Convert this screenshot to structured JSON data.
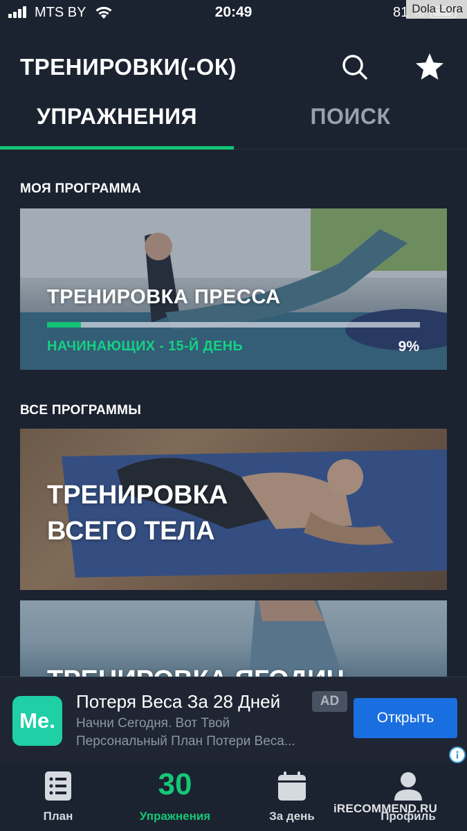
{
  "status_bar": {
    "carrier": "MTS BY",
    "time": "20:49",
    "battery": "81 %"
  },
  "watermark_top": "Dola Lora",
  "header": {
    "title": "ТРЕНИРОВКИ(-ОК)",
    "search_icon": "search-icon",
    "favorite_icon": "star-icon"
  },
  "tabs": [
    {
      "label": "УПРАЖНЕНИЯ",
      "active": true
    },
    {
      "label": "ПОИСК",
      "active": false
    }
  ],
  "my_program": {
    "section_title": "МОЯ ПРОГРАММА",
    "card": {
      "title": "ТРЕНИРОВКА ПРЕССА",
      "subtitle": "НАЧИНАЮЩИХ - 15-Й ДЕНЬ",
      "progress_label": "9%",
      "progress_value": 0.09
    }
  },
  "all_programs": {
    "section_title": "ВСЕ ПРОГРАММЫ",
    "cards": [
      {
        "title_line1": "ТРЕНИРОВКА",
        "title_line2": "ВСЕГО ТЕЛА"
      },
      {
        "title": "ТРЕНИРОВКА ЯГОДИЦ"
      }
    ]
  },
  "ad": {
    "logo_text": "Me.",
    "title": "Потеря Веса За 28 Дней",
    "badge": "AD",
    "text_line1": "Начни Сегодня. Вот Твой",
    "text_line2": "Персональный План Потери Веса...",
    "button": "Открыть"
  },
  "bottom_nav": [
    {
      "label": "План",
      "icon": "list-icon",
      "active": false
    },
    {
      "label": "Упражнения",
      "number": "30",
      "active": true
    },
    {
      "label": "За день",
      "icon": "calendar-icon",
      "active": false
    },
    {
      "label": "Профиль",
      "icon": "profile-icon",
      "active": false
    }
  ],
  "watermark_bottom": "iRECOMMEND.RU",
  "colors": {
    "background": "#1b2230",
    "accent": "#12c275",
    "ad_button": "#1a6fe0"
  }
}
